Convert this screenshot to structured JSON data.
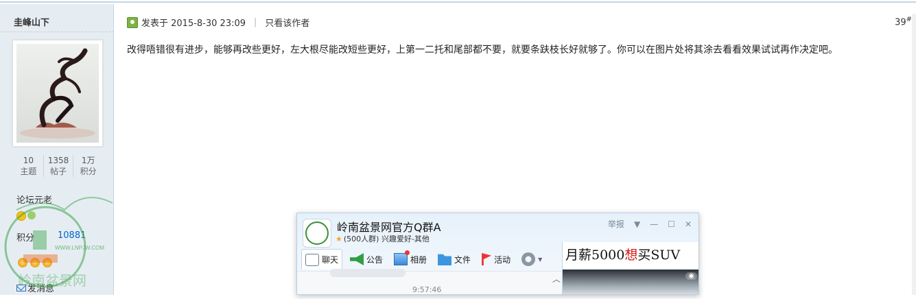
{
  "author": {
    "name": "圭峰山下"
  },
  "stats": [
    {
      "value": "10",
      "label": "主题"
    },
    {
      "value": "1358",
      "label": "帖子"
    },
    {
      "value": "1万",
      "label": "积分"
    }
  ],
  "profile": {
    "title": "论坛元老",
    "points_label": "积分",
    "points_value": "10881",
    "send_message": "发消息"
  },
  "watermark": {
    "url": "WWW.LNPJW.COM",
    "text": "岭南盆景网"
  },
  "post": {
    "posted_at": "发表于 2015-8-30 23:09",
    "only_author": "只看该作者",
    "floor": "39",
    "floor_mark": "#",
    "content": "改得唔错很有进步，能够再改些更好，左大根尽能改短些更好，上第一二托和尾部都不要，就要条趺枝长好就够了。你可以在图片处将其涂去看看效果试试再作决定吧。"
  },
  "qq_window": {
    "group_name": "岭南盆景网官方Q群A",
    "group_info": "(500人群) 兴趣爱好-其他",
    "report": "举报",
    "tabs": [
      {
        "label": "聊天",
        "icon": "chat-icon"
      },
      {
        "label": "公告",
        "icon": "notice-icon"
      },
      {
        "label": "相册",
        "icon": "photo-icon"
      },
      {
        "label": "文件",
        "icon": "folder-icon"
      },
      {
        "label": "活动",
        "icon": "flag-icon"
      }
    ],
    "chat_time": "9:57:46",
    "ad": {
      "text_before": "月薪5000",
      "text_highlight": "想",
      "text_after": "买SUV"
    }
  }
}
